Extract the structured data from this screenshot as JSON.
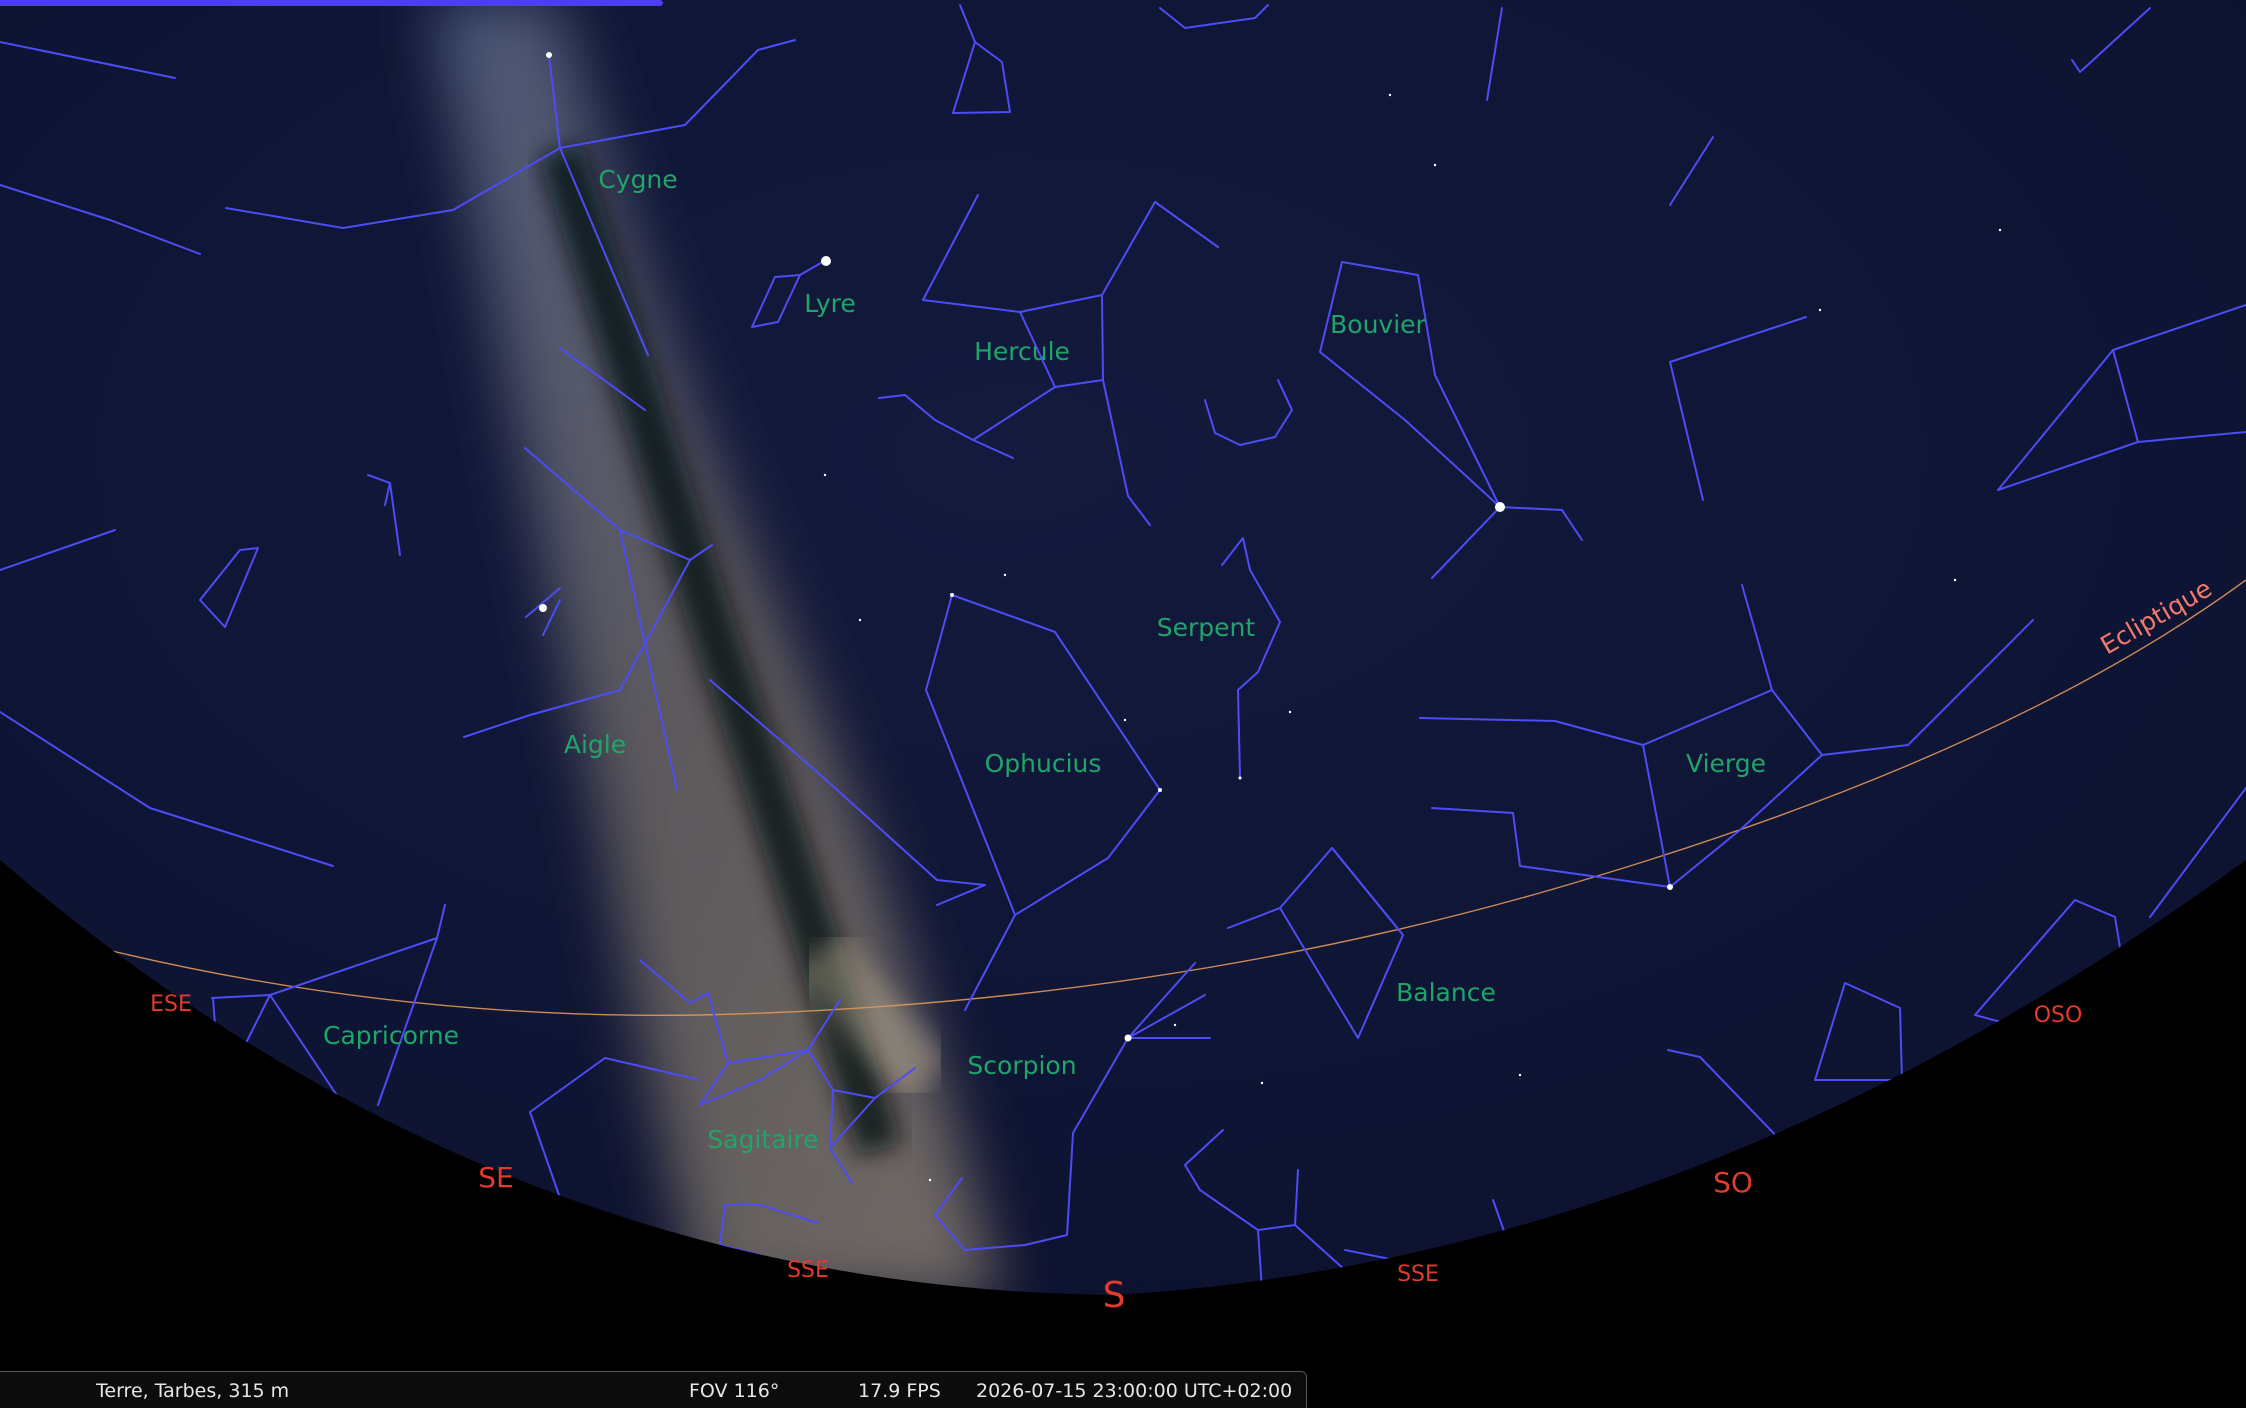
{
  "progress": 0.295,
  "constellations": [
    {
      "name": "Cygne"
    },
    {
      "name": "Lyre"
    },
    {
      "name": "Hercule"
    },
    {
      "name": "Bouvier"
    },
    {
      "name": "Aigle"
    },
    {
      "name": "Serpent"
    },
    {
      "name": "Ophucius"
    },
    {
      "name": "Vierge"
    },
    {
      "name": "Balance"
    },
    {
      "name": "Capricorne"
    },
    {
      "name": "Scorpion"
    },
    {
      "name": "Sagitaire"
    }
  ],
  "horizon": {
    "ese": "ESE",
    "se": "SE",
    "sse_left": "SSE",
    "s": "S",
    "sse_right": "SSE",
    "so": "SO",
    "oso": "OSO"
  },
  "ecliptic_label": "Ecliptique",
  "status": {
    "location": "Terre, Tarbes, 315 m",
    "fov": "FOV 116°",
    "fps": "17.9 FPS",
    "datetime": "2026-07-15 23:00:00 UTC+02:00"
  },
  "colors": {
    "constellation_lines": "#4d4cf5",
    "constellation_labels": "#1fa56a",
    "cardinal_points": "#e23a2c",
    "ecliptic": "#e0975a",
    "sky": "#0e1433",
    "ground": "#000000"
  }
}
